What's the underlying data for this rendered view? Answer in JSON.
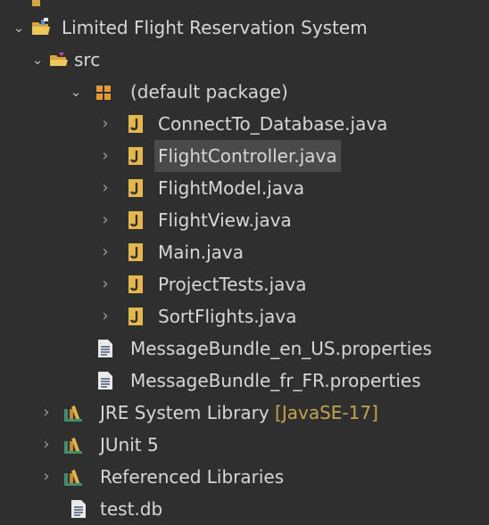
{
  "tree": {
    "root": {
      "label": "Limited Flight Reservation System",
      "icon": "java-project-folder-icon"
    },
    "src_folder": {
      "label": "src",
      "icon": "source-folder-icon"
    },
    "package": {
      "label": "(default package)",
      "icon": "package-icon"
    },
    "java_files": [
      {
        "label": "ConnectTo_Database.java",
        "icon": "java-file-icon"
      },
      {
        "label": "FlightController.java",
        "icon": "java-file-icon",
        "selected": true
      },
      {
        "label": "FlightModel.java",
        "icon": "java-file-icon"
      },
      {
        "label": "FlightView.java",
        "icon": "java-file-icon"
      },
      {
        "label": "Main.java",
        "icon": "java-file-icon"
      },
      {
        "label": "ProjectTests.java",
        "icon": "java-file-icon"
      },
      {
        "label": "SortFlights.java",
        "icon": "java-file-icon"
      }
    ],
    "property_files": [
      {
        "label": "MessageBundle_en_US.properties",
        "icon": "properties-file-icon"
      },
      {
        "label": "MessageBundle_fr_FR.properties",
        "icon": "properties-file-icon"
      }
    ],
    "libraries": [
      {
        "label": "JRE System Library",
        "decoration": "[JavaSE-17]",
        "icon": "library-icon"
      },
      {
        "label": "JUnit 5",
        "icon": "library-icon"
      },
      {
        "label": "Referenced Libraries",
        "icon": "library-icon"
      }
    ],
    "db_file": {
      "label": "test.db",
      "icon": "file-icon"
    }
  },
  "colors": {
    "background": "#2f2f2f",
    "text": "#d7d7d7",
    "selection": "#4a4a4a",
    "decoration": "#c4a44b",
    "java_icon": "#e6b84c",
    "folder_icon": "#d6a53c",
    "library_icon": "#3f8f6e"
  }
}
